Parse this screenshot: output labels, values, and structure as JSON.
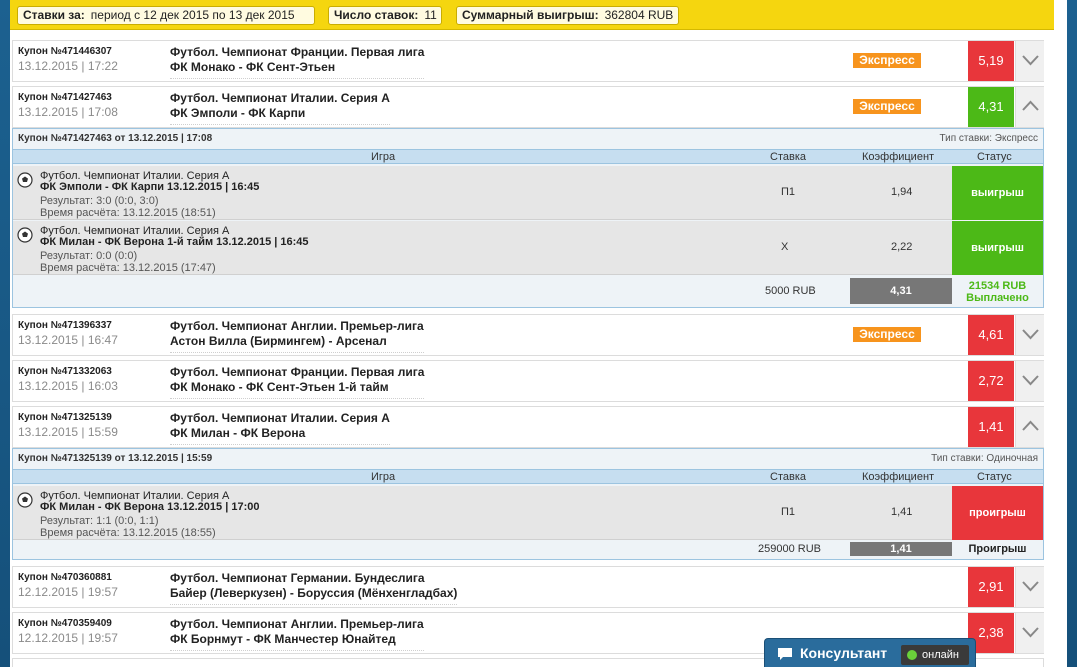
{
  "summary": {
    "period_label": "Ставки за:",
    "period_value": "период с 12 дек 2015 по 13 дек 2015",
    "count_label": "Число ставок:",
    "count_value": "11",
    "win_label": "Суммарный выигрыш:",
    "win_value": "362804 RUB"
  },
  "coupons": [
    {
      "num": "Купон №471446307",
      "date": "13.12.2015 | 17:22",
      "event_line1": "Футбол. Чемпионат Франции. Первая лига",
      "event_line2": "ФК Монако - ФК Сент-Этьен",
      "badge": "Экспресс",
      "coef": "5,19",
      "coef_color": "#e8363b",
      "toggle": "chevron-down-icon"
    },
    {
      "num": "Купон №471427463",
      "date": "13.12.2015 | 17:08",
      "event_line1": "Футбол. Чемпионат Италии. Серия А",
      "event_line2": "ФК Эмполи - ФК Карпи",
      "badge": "Экспресс",
      "coef": "4,31",
      "coef_color": "#4cb917",
      "toggle": "chevron-up-icon"
    },
    {
      "num": "Купон №471396337",
      "date": "13.12.2015 | 16:47",
      "event_line1": "Футбол. Чемпионат Англии. Премьер-лига",
      "event_line2": "Астон Вилла (Бирмингем) - Арсенал",
      "badge": "Экспресс",
      "coef": "4,61",
      "coef_color": "#e8363b",
      "toggle": "chevron-down-icon"
    },
    {
      "num": "Купон №471332063",
      "date": "13.12.2015 | 16:03",
      "event_line1": "Футбол. Чемпионат Франции. Первая лига",
      "event_line2": "ФК Монако - ФК Сент-Этьен 1-й тайм",
      "badge": "",
      "coef": "2,72",
      "coef_color": "#e8363b",
      "toggle": "chevron-down-icon"
    },
    {
      "num": "Купон №471325139",
      "date": "13.12.2015 | 15:59",
      "event_line1": "Футбол. Чемпионат Италии. Серия А",
      "event_line2": "ФК Милан - ФК Верона",
      "badge": "",
      "coef": "1,41",
      "coef_color": "#e8363b",
      "toggle": "chevron-up-icon"
    },
    {
      "num": "Купон №470360881",
      "date": "12.12.2015 | 19:57",
      "event_line1": "Футбол. Чемпионат Германии. Бундеслига",
      "event_line2": "Байер (Леверкузен) - Боруссия (Мёнхенгладбах)",
      "badge": "",
      "coef": "2,91",
      "coef_color": "#e8363b",
      "toggle": "chevron-down-icon"
    },
    {
      "num": "Купон №470359409",
      "date": "12.12.2015 | 19:57",
      "event_line1": "Футбол. Чемпионат Англии. Премьер-лига",
      "event_line2": "ФК Борнмут - ФК Манчестер Юнайтед",
      "badge": "",
      "coef": "2,38",
      "coef_color": "#e8363b",
      "toggle": "chevron-down-icon"
    }
  ],
  "table_headers": {
    "game": "Игра",
    "stake": "Ставка",
    "coef": "Коэффициент",
    "status": "Статус"
  },
  "details": [
    {
      "header": "Купон №471427463 от 13.12.2015 | 17:08",
      "type": "Тип ставки: Экспресс",
      "bets": [
        {
          "champ": "Футбол. Чемпионат Италии. Серия А",
          "match": "ФК Эмполи - ФК Карпи 13.12.2015 | 16:45",
          "result": "Результат: 3:0 (0:0, 3:0)",
          "calc": "Время расчёта: 13.12.2015 (18:51)",
          "stake": "П1",
          "coef": "1,94",
          "status": "выигрыш"
        },
        {
          "champ": "Футбол. Чемпионат Италии. Серия А",
          "match": "ФК Милан - ФК Верона 1-й тайм 13.12.2015 | 16:45",
          "result": "Результат: 0:0 (0:0)",
          "calc": "Время расчёта: 13.12.2015 (17:47)",
          "stake": "Х",
          "coef": "2,22",
          "status": "выигрыш"
        }
      ],
      "total_stake": "5000 RUB",
      "total_coef": "4,31",
      "total_result_line1": "21534 RUB",
      "total_result_line2": "Выплачено",
      "total_result_color": "#4cb917"
    },
    {
      "header": "Купон №471325139 от 13.12.2015 | 15:59",
      "type": "Тип ставки: Одиночная",
      "bets": [
        {
          "champ": "Футбол. Чемпионат Италии. Серия А",
          "match": "ФК Милан - ФК Верона 13.12.2015 | 17:00",
          "result": "Результат: 1:1 (0:0, 1:1)",
          "calc": "Время расчёта: 13.12.2015 (18:55)",
          "stake": "П1",
          "coef": "1,41",
          "status": "проигрыш"
        }
      ],
      "total_stake": "259000 RUB",
      "total_coef": "1,41",
      "total_result_line1": "Проигрыш",
      "total_result_line2": "",
      "total_result_color": "#222222"
    }
  ],
  "consultant": {
    "title": "Консультант",
    "status": "онлайн"
  }
}
